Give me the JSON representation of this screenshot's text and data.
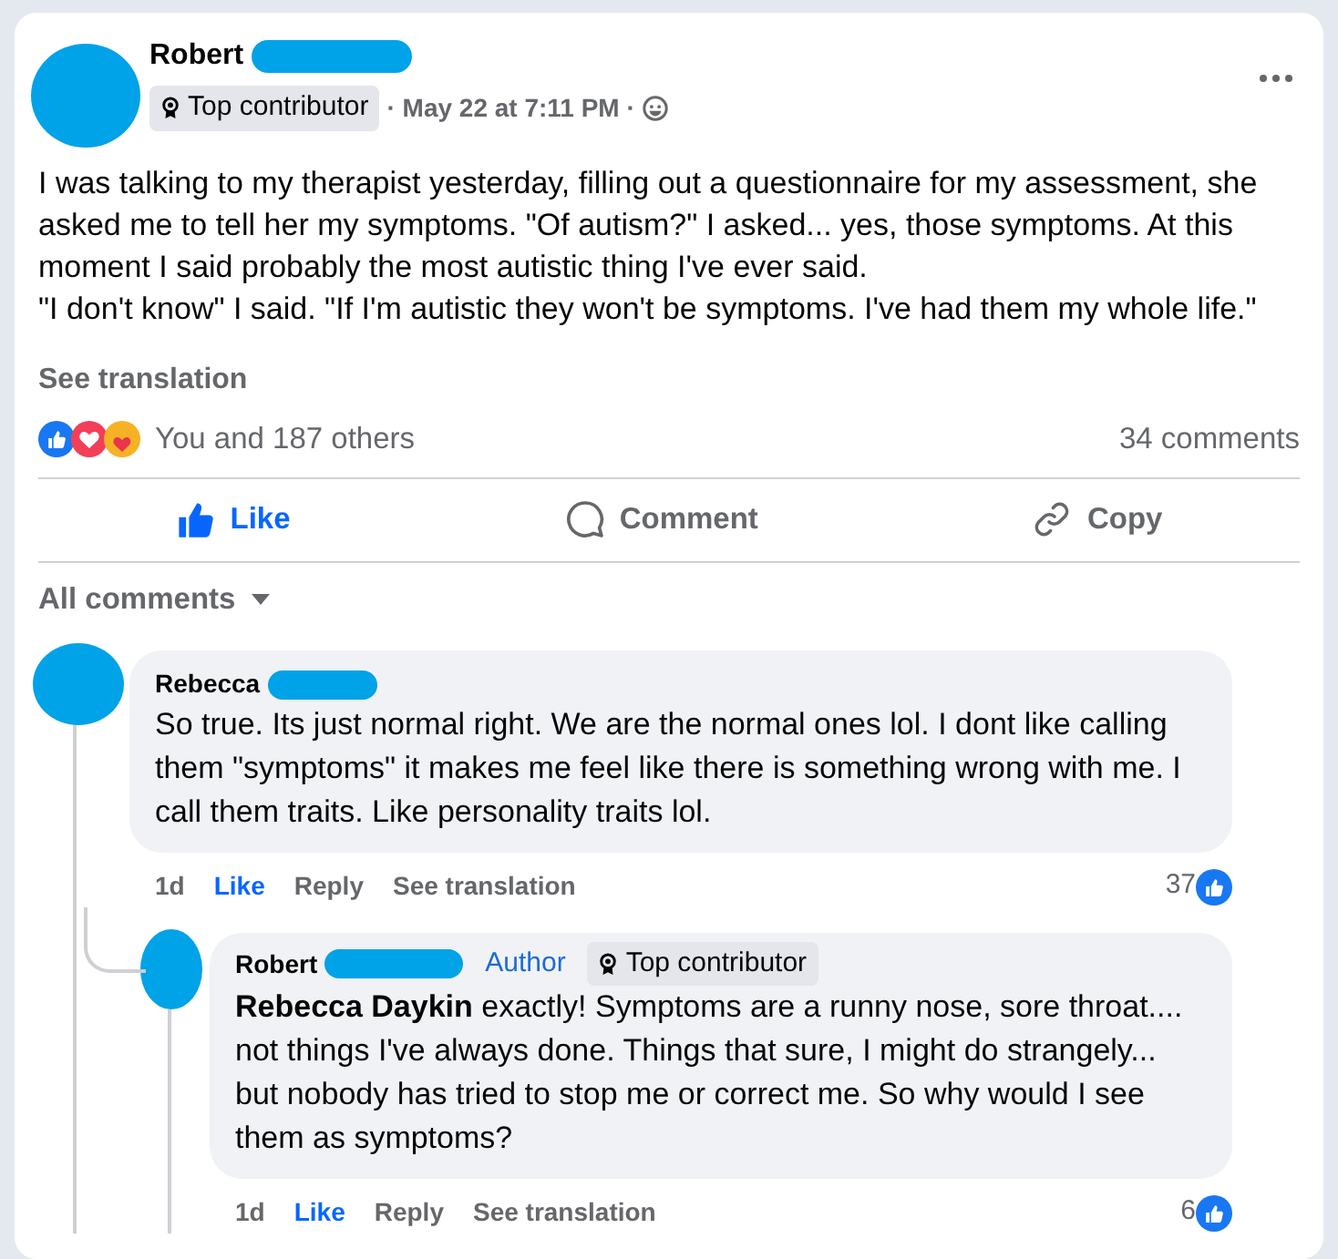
{
  "post": {
    "author": "Robert",
    "badge": "Top contributor",
    "meta": "· May 22 at 7:11 PM ·",
    "paragraphs": [
      "I was talking to my therapist yesterday,  filling out a questionnaire for my assessment, she asked me to tell her my symptoms. \"Of autism?\" I asked... yes, those symptoms. At this moment I said probably the most autistic thing I've ever said.",
      "\"I don't know\" I said. \"If I'm autistic they won't be symptoms. I've had them my whole life.\""
    ],
    "see_translation": "See translation",
    "reactions_summary": "You and 187 others",
    "comment_count": "34 comments",
    "actions": [
      {
        "label": "Like",
        "kind": "like",
        "selected": true
      },
      {
        "label": "Comment",
        "kind": "comment",
        "selected": false
      },
      {
        "label": "Copy",
        "kind": "copy",
        "selected": false
      }
    ]
  },
  "comments_filter": "All comments",
  "comments": [
    {
      "author": "Rebecca",
      "text": "So true. Its just normal right. We are the normal ones lol. I dont like calling them \"symptoms\" it makes me feel like there is something wrong with me. I call them traits. Like personality traits lol.",
      "time": "1d",
      "like": "Like",
      "liked": true,
      "reply": "Reply",
      "see_translation": "See translation",
      "reaction_count": "37",
      "replies": [
        {
          "author": "Robert",
          "author_label": "Author",
          "badge": "Top contributor",
          "text": "**Rebecca Daykin** exactly! Symptoms are a runny nose, sore throat.... not things I've always done. Things that sure, I might do strangely... but nobody has tried to stop me or correct me. So why would I see them as symptoms?",
          "time": "1d",
          "like": "Like",
          "liked": true,
          "reply": "Reply",
          "see_translation": "See translation",
          "reaction_count": "6"
        }
      ]
    }
  ]
}
